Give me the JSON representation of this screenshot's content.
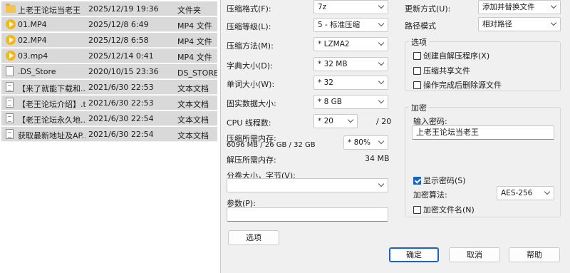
{
  "files": [
    {
      "name": "上老王论坛当老王",
      "date": "2025/12/19 19:36",
      "type": "文件夹",
      "icon": "folder-icon"
    },
    {
      "name": "01.MP4",
      "date": "2025/12/8 6:49",
      "type": "MP4 文件",
      "icon": "media-file-icon"
    },
    {
      "name": "02.MP4",
      "date": "2025/12/8 6:58",
      "type": "MP4 文件",
      "icon": "media-file-icon"
    },
    {
      "name": "03.mp4",
      "date": "2025/12/14 0:41",
      "type": "MP4 文件",
      "icon": "media-file-icon"
    },
    {
      "name": ".DS_Store",
      "date": "2020/10/15 23:36",
      "type": "DS_STORE 文",
      "icon": "blank-file-icon"
    },
    {
      "name": "【来了就能下载和...",
      "date": "2021/6/30 22:53",
      "type": "文本文档",
      "icon": "text-file-icon"
    },
    {
      "name": "【老王论坛介绍】.txt",
      "date": "2021/6/30 22:53",
      "type": "文本文档",
      "icon": "text-file-icon"
    },
    {
      "name": "【老王论坛永久地...",
      "date": "2021/6/30 22:54",
      "type": "文本文档",
      "icon": "text-file-icon"
    },
    {
      "name": "获取最新地址及AP...",
      "date": "2021/6/30 22:54",
      "type": "文本文档",
      "icon": "text-file-icon"
    }
  ],
  "dialog": {
    "format": {
      "label": "压缩格式(F):",
      "value": "7z"
    },
    "level": {
      "label": "压缩等级(L):",
      "value": "5 - 标准压缩"
    },
    "method": {
      "label": "压缩方法(M):",
      "value": "* LZMA2"
    },
    "dict": {
      "label": "字典大小(D):",
      "value": "* 32 MB"
    },
    "word": {
      "label": "单词大小(W):",
      "value": "* 32"
    },
    "solid": {
      "label": "固实数据大小:",
      "value": "* 8 GB"
    },
    "threads": {
      "label": "CPU 线程数:",
      "value": "* 20",
      "max": "/ 20"
    },
    "mem_compress": {
      "label": "压缩所需内存:",
      "detail": "6096 MB / 26 GB / 32 GB",
      "percent": "* 80%"
    },
    "mem_decompress": {
      "label": "解压所需内存:",
      "value": "34 MB"
    },
    "split": {
      "label": "分卷大小，字节(V):",
      "value": ""
    },
    "params": {
      "label": "参数(P):",
      "value": ""
    },
    "options_button": "选项",
    "update": {
      "label": "更新方式(U):",
      "value": "添加并替换文件"
    },
    "path_mode": {
      "label": "路径模式",
      "value": "相对路径"
    },
    "options_group": {
      "title": "选项",
      "sfx": {
        "label": "创建自解压程序(X)",
        "checked": false
      },
      "shared": {
        "label": "压缩共享文件",
        "checked": false
      },
      "delete": {
        "label": "操作完成后删除源文件",
        "checked": false
      }
    },
    "encryption": {
      "title": "加密",
      "password_label": "输入密码:",
      "password_value": "上老王论坛当老王",
      "show_password": {
        "label": "显示密码(S)",
        "checked": true
      },
      "method_label": "加密算法:",
      "method_value": "AES-256",
      "encrypt_names": {
        "label": "加密文件名(N)",
        "checked": false
      }
    },
    "buttons": {
      "ok": "确定",
      "cancel": "取消",
      "help": "帮助"
    }
  },
  "colors": {
    "selection": "#d9d9d9",
    "accent": "#1a62c4",
    "dialog_bg": "#f0f0f0"
  }
}
